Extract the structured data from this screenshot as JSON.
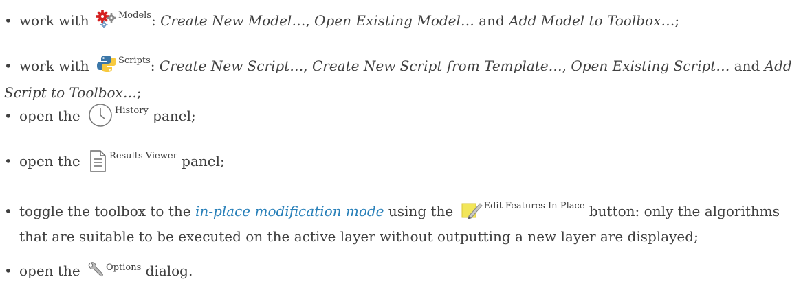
{
  "items": [
    {
      "lead": "work with",
      "icon_name": "models-icon",
      "icon_label": "Models",
      "sep": ":",
      "actions": [
        "Create New Model…",
        "Open Existing Model…",
        "Add Model to Toolbox…"
      ],
      "joiner": ",",
      "and_word": "and",
      "end": ";"
    },
    {
      "lead": "work with",
      "icon_name": "python-scripts-icon",
      "icon_label": "Scripts",
      "sep": ":",
      "actions": [
        "Create New Script…",
        "Create New Script from Template…",
        "Open Existing Script…",
        "Add Script to Toolbox…"
      ],
      "joiner": ",",
      "and_word": "and",
      "end": ";"
    },
    {
      "lead": "open the",
      "icon_name": "history-clock-icon",
      "icon_label": "History",
      "tail": "panel;"
    },
    {
      "lead": "open the",
      "icon_name": "results-viewer-icon",
      "icon_label": "Results Viewer",
      "tail": "panel;"
    },
    {
      "lead": "toggle the toolbox to the",
      "link_text": "in-place modification mode",
      "mid": "using the",
      "icon_name": "edit-features-in-place-icon",
      "icon_label": "Edit Features In-Place",
      "tail_1": "button: only the algorithms",
      "tail_2": "that are suitable to be executed on the active layer without outputting a new layer are displayed;"
    },
    {
      "lead": "open the",
      "icon_name": "options-wrench-icon",
      "icon_label": "Options",
      "tail": "dialog."
    }
  ],
  "bullet_char": "•",
  "colors": {
    "text": "#404040",
    "link": "#2980b9",
    "python_blue": "#3b77a8",
    "python_yellow": "#f7c93e",
    "gear_red": "#d42020",
    "gear_grey": "#8a8a8a",
    "note_yellow": "#f2e65a"
  }
}
